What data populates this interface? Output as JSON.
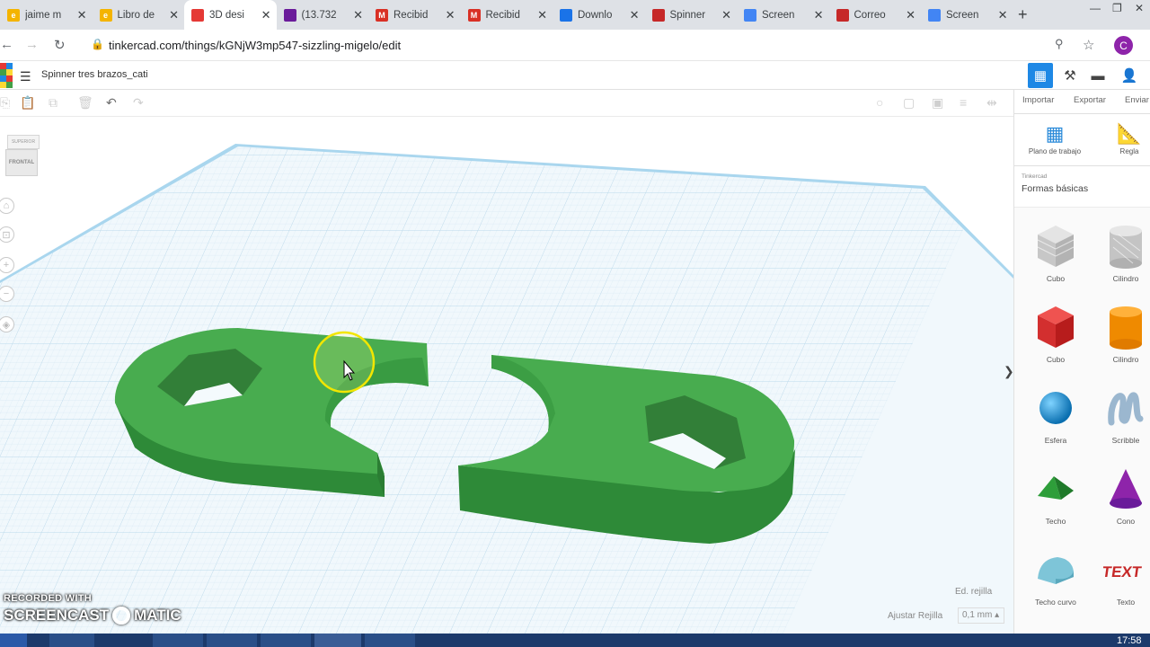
{
  "tabs": [
    {
      "label": "jaime m",
      "icon": "document-icon",
      "color": "#f4b400",
      "glyph": "e"
    },
    {
      "label": "Libro de",
      "icon": "document-icon",
      "color": "#f4b400",
      "glyph": "e"
    },
    {
      "label": "3D desi",
      "icon": "tinkercad-icon",
      "color": "#e53935",
      "glyph": "",
      "active": true
    },
    {
      "label": "(13.732",
      "icon": "mail-icon",
      "color": "#6a1b9a",
      "glyph": ""
    },
    {
      "label": "Recibid",
      "icon": "gmail-icon",
      "color": "#d93025",
      "glyph": "M"
    },
    {
      "label": "Recibid",
      "icon": "gmail-icon",
      "color": "#d93025",
      "glyph": "M"
    },
    {
      "label": "Downlo",
      "icon": "drive-icon",
      "color": "#1a73e8",
      "glyph": ""
    },
    {
      "label": "Spinner",
      "icon": "gear-icon",
      "color": "#c62828",
      "glyph": ""
    },
    {
      "label": "Screen",
      "icon": "globe-icon",
      "color": "#4285f4",
      "glyph": ""
    },
    {
      "label": "Correo",
      "icon": "mail-icon",
      "color": "#c62828",
      "glyph": ""
    },
    {
      "label": "Screen",
      "icon": "globe-icon",
      "color": "#4285f4",
      "glyph": ""
    }
  ],
  "address_bar": {
    "url": "tinkercad.com/things/kGNjW3mp547-sizzling-migelo/edit",
    "avatar_letter": "C"
  },
  "project": {
    "name": "Spinner tres brazos_cati"
  },
  "panel": {
    "import_label": "Importar",
    "export_label": "Exportar",
    "send_label": "Enviar",
    "workplane_label": "Plano de trabajo",
    "ruler_label": "Regla",
    "category_source": "Tinkercad",
    "category_name": "Formas básicas",
    "shapes": [
      {
        "label": "Cubo",
        "icon": "cube-hole-icon"
      },
      {
        "label": "Cilindro",
        "icon": "cylinder-hole-icon"
      },
      {
        "label": "Cubo",
        "icon": "cube-icon"
      },
      {
        "label": "Cilindro",
        "icon": "cylinder-icon"
      },
      {
        "label": "Esfera",
        "icon": "sphere-icon"
      },
      {
        "label": "Scribble",
        "icon": "scribble-icon"
      },
      {
        "label": "Techo",
        "icon": "roof-icon"
      },
      {
        "label": "Cono",
        "icon": "cone-icon"
      },
      {
        "label": "Techo curvo",
        "icon": "round-roof-icon"
      },
      {
        "label": "Texto",
        "icon": "text-icon"
      }
    ]
  },
  "viewport": {
    "viewcube_top": "SUPERIOR",
    "viewcube_front": "FRONTAL",
    "edit_grid_label": "Ed. rejilla",
    "snap_grid_label": "Ajustar Rejilla",
    "snap_grid_value": "0,1 mm",
    "watermark_line1": "RECORDED WITH",
    "watermark_line2_left": "SCREENCAST",
    "watermark_line2_right": "MATIC"
  },
  "taskbar": {
    "time": "17:58"
  },
  "colors": {
    "shape_green": "#3fa34a",
    "grid_blue": "#cfe6f3",
    "accent_blue": "#1e88e5"
  }
}
